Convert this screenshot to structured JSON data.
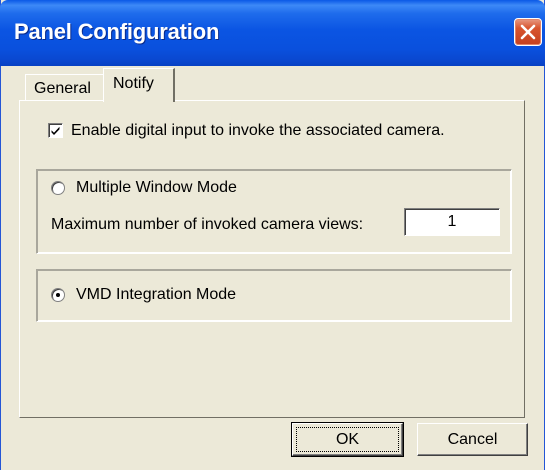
{
  "window": {
    "title": "Panel Configuration",
    "close_icon": "close-x-icon"
  },
  "tabs": [
    {
      "label": "General",
      "selected": false
    },
    {
      "label": "Notify",
      "selected": true
    }
  ],
  "notify": {
    "enable_checkbox": {
      "label": "Enable digital input to invoke the associated camera.",
      "checked": true
    },
    "multiple_window_mode": {
      "label": "Multiple Window Mode",
      "selected": false,
      "max_views_label": "Maximum number of invoked camera views:",
      "max_views_value": "1"
    },
    "vmd_integration_mode": {
      "label": "VMD Integration Mode",
      "selected": true
    }
  },
  "buttons": {
    "ok_label": "OK",
    "cancel_label": "Cancel"
  },
  "colors": {
    "title_bar": "#0a50dd",
    "close_button": "#d8552f",
    "dialog_face": "#ece9d8"
  }
}
